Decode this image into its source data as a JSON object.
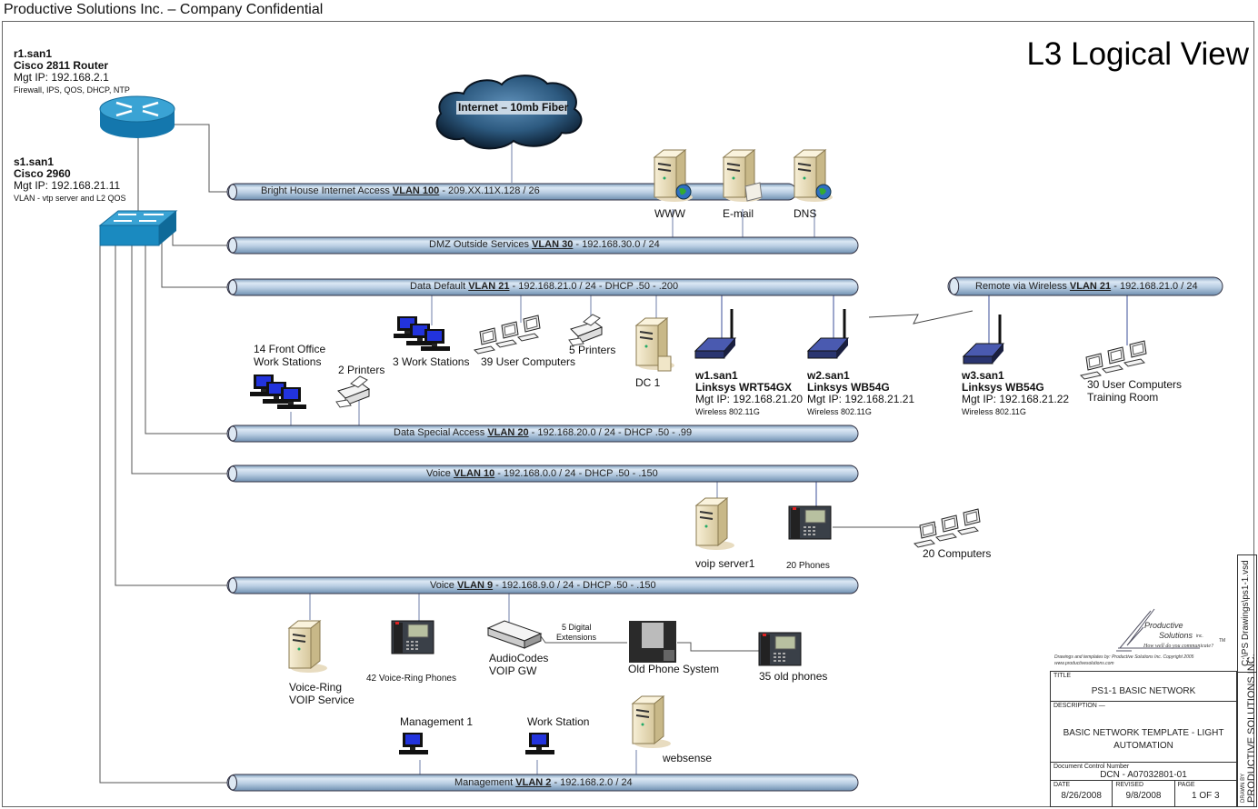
{
  "header": {
    "title": "Productive Solutions Inc. – Company Confidential"
  },
  "view_title": "L3 Logical View",
  "router": {
    "name": "r1.san1",
    "model": "Cisco 2811 Router",
    "mgt_ip": "Mgt IP: 192.168.2.1",
    "features": "Firewall, IPS, QOS, DHCP, NTP"
  },
  "switch": {
    "name": "s1.san1",
    "model": "Cisco 2960",
    "mgt_ip": "Mgt IP: 192.168.21.11",
    "features": "VLAN - vtp server and L2 QOS"
  },
  "cloud": {
    "label": "Internet – 10mb Fiber"
  },
  "vlans": [
    {
      "pre": "Bright House Internet Access ",
      "vlan": "VLAN 100",
      "post": " - 209.XX.11X.128 / 26"
    },
    {
      "pre": "DMZ Outside Services ",
      "vlan": "VLAN 30",
      "post": " - 192.168.30.0 / 24"
    },
    {
      "pre": "Data Default ",
      "vlan": "VLAN 21",
      "post": " - 192.168.21.0 / 24  - DHCP .50 - .200"
    },
    {
      "pre": "Remote via Wireless ",
      "vlan": "VLAN 21",
      "post": " - 192.168.21.0 / 24"
    },
    {
      "pre": "Data Special Access ",
      "vlan": "VLAN 20",
      "post": " - 192.168.20.0 / 24  - DHCP .50 - .99"
    },
    {
      "pre": "Voice ",
      "vlan": "VLAN 10",
      "post": " - 192.168.0.0 / 24  - DHCP .50 - .150"
    },
    {
      "pre": "Voice ",
      "vlan": "VLAN 9",
      "post": " - 192.168.9.0 / 24  - DHCP .50 - .150"
    },
    {
      "pre": "Management ",
      "vlan": "VLAN 2",
      "post": " - 192.168.2.0 / 24"
    }
  ],
  "dmz_servers": [
    "WWW",
    "E-mail",
    "DNS"
  ],
  "data_default_devices": {
    "workstations": "3 Work Stations",
    "user_computers": "39 User Computers",
    "printers": "5 Printers",
    "dc": "DC 1"
  },
  "data_special_devices": {
    "front_office_1": "14 Front Office",
    "front_office_2": "Work Stations",
    "printers": "2 Printers"
  },
  "wireless": [
    {
      "name": "w1.san1",
      "model": "Linksys WRT54GX",
      "mgt_ip": "Mgt IP: 192.168.21.20",
      "std": "Wireless 802.11G"
    },
    {
      "name": "w2.san1",
      "model": "Linksys WB54G",
      "mgt_ip": "Mgt IP: 192.168.21.21",
      "std": "Wireless 802.11G"
    },
    {
      "name": "w3.san1",
      "model": "Linksys WB54G",
      "mgt_ip": "Mgt IP: 192.168.21.22",
      "std": "Wireless 802.11G"
    }
  ],
  "training": {
    "line1": "30 User Computers",
    "line2": "Training Room"
  },
  "voice10": {
    "server": "voip server1",
    "phones": "20 Phones",
    "computers": "20 Computers"
  },
  "voice9": {
    "server_1": "Voice-Ring",
    "server_2": "VOIP Service",
    "phones": "42 Voice-Ring Phones",
    "gw_1": "AudioCodes",
    "gw_2": "VOIP GW",
    "ext_1": "5 Digital",
    "ext_2": "Extensions",
    "old_system": "Old Phone System",
    "old_phones": "35 old phones"
  },
  "management": {
    "m1": "Management 1",
    "ws": "Work Station",
    "websense": "websense"
  },
  "logo": {
    "line1": "Productive",
    "line2": "Solutions",
    "inc": "inc.",
    "tm": "TM",
    "tagline": "How well do you communicate?",
    "credit": "Drawings and templates by: Productive Solutions Inc. Copyright 2005",
    "url": "www.productivesolutions.com"
  },
  "title_block": {
    "title_cap": "TITLE",
    "title": "PS1-1 BASIC NETWORK",
    "desc_cap": "DESCRIPTION —",
    "desc": "BASIC NETWORK TEMPLATE - LIGHT AUTOMATION",
    "dcn_cap": "Document Control Number",
    "dcn": "DCN - A07032801-01",
    "date_cap": "DATE",
    "date": "8/26/2008",
    "rev_cap": "REVISED",
    "rev": "9/8/2008",
    "page_cap": "PAGE",
    "page": "1 OF 3",
    "file": "C:\\PS Drawings\\ps1-1.vsd",
    "drawn_by_cap": "DRAWN BY",
    "drawn_by": "PRODUCTIVE SOLUTIONS INC."
  }
}
